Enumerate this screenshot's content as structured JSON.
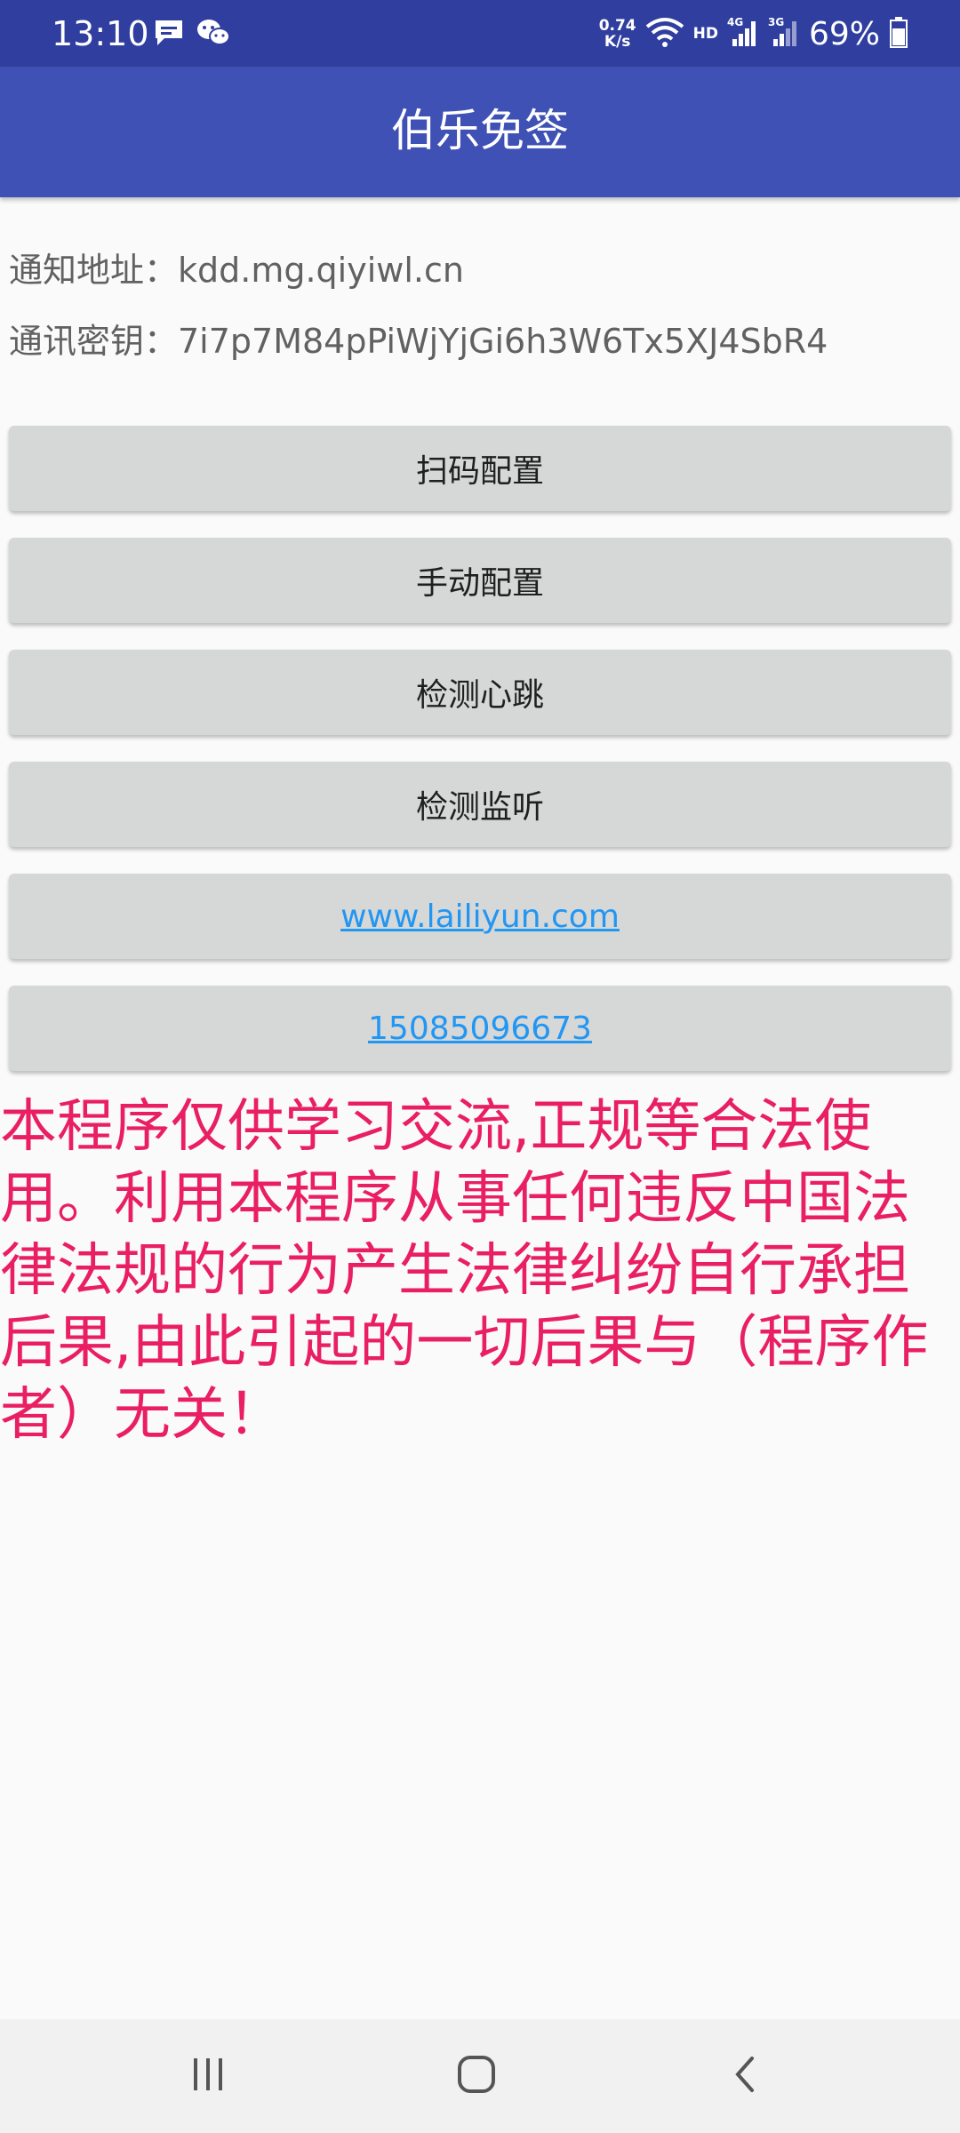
{
  "status_bar": {
    "time": "13:10",
    "speed_value": "0.74",
    "speed_unit": "K/s",
    "hd": "HD",
    "battery": "69%",
    "icons": [
      "message-icon",
      "wechat-icon",
      "wifi-icon",
      "signal-4g-icon",
      "signal-3g-icon",
      "battery-icon"
    ]
  },
  "app_bar": {
    "title": "伯乐免签"
  },
  "info": {
    "notify_address": "通知地址：kdd.mg.qiyiwl.cn",
    "secret_key": "通讯密钥：7i7p7M84pPiWjYjGi6h3W6Tx5XJ4SbR4"
  },
  "buttons": {
    "scan_config": "扫码配置",
    "manual_config": "手动配置",
    "check_heartbeat": "检测心跳",
    "check_listener": "检测监听",
    "website": "www.lailiyun.com",
    "phone": "15085096673"
  },
  "notice": "本程序仅供学习交流,正规等合法使用。利用本程序从事任何违反中国法律法规的行为产生法律纠纷自行承担后果,由此引起的一切后果与（程序作者）无关！",
  "colors": {
    "status_bar": "#303f9f",
    "app_bar": "#3f51b5",
    "notice": "#e91e63",
    "link": "#2196f3",
    "button": "#d6d7d7"
  }
}
